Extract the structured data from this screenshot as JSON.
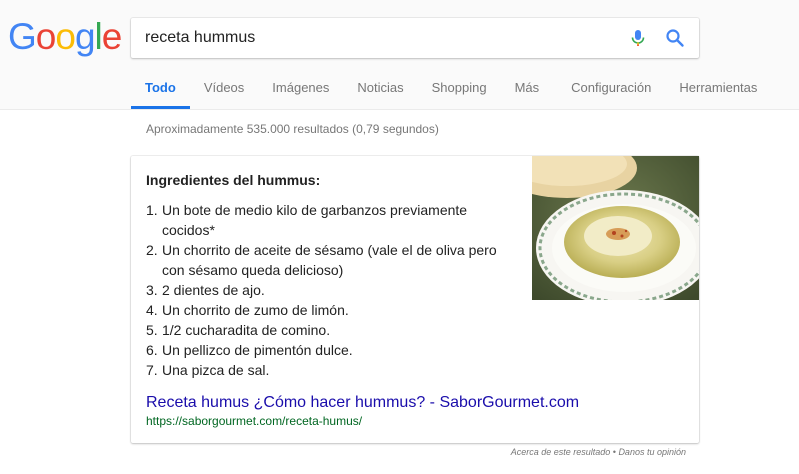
{
  "logo": {
    "text": "Google",
    "letters": [
      "G",
      "o",
      "o",
      "g",
      "l",
      "e"
    ],
    "colors": [
      "#4285F4",
      "#EA4335",
      "#FBBC05",
      "#4285F4",
      "#34A853",
      "#EA4335"
    ]
  },
  "search": {
    "value": "receta hummus",
    "mic_icon": "mic-icon",
    "search_icon": "search-icon"
  },
  "tabs": [
    {
      "label": "Todo",
      "active": true
    },
    {
      "label": "Vídeos"
    },
    {
      "label": "Imágenes"
    },
    {
      "label": "Noticias"
    },
    {
      "label": "Shopping"
    },
    {
      "label": "Más"
    },
    {
      "label": "Configuración"
    },
    {
      "label": "Herramientas"
    }
  ],
  "stats": "Aproximadamente 535.000 resultados (0,79 segundos)",
  "snippet": {
    "title": "Ingredientes del hummus:",
    "steps": [
      {
        "num": "1.",
        "text": "Un bote de medio kilo de garbanzos previamente cocidos*"
      },
      {
        "num": "2.",
        "text": "Un chorrito de aceite de sésamo (vale el de oliva pero con sésamo queda delicioso)"
      },
      {
        "num": "3.",
        "text": "2 dientes de ajo."
      },
      {
        "num": "4.",
        "text": "Un chorrito de zumo de limón."
      },
      {
        "num": "5.",
        "text": "1/2 cucharadita de comino."
      },
      {
        "num": "6.",
        "text": "Un pellizco de pimentón dulce."
      },
      {
        "num": "7.",
        "text": "Una pizca de sal."
      }
    ],
    "link_title": "Receta humus ¿Cómo hacer hummus? - SaborGourmet.com",
    "url": "https://saborgourmet.com/receta-humus/"
  },
  "footer": {
    "about": "Acerca de este resultado",
    "separator": " • ",
    "feedback": "Danos tu opinión"
  },
  "colors": {
    "link": "#1a0dab",
    "url": "#006621",
    "accent": "#1a73e8"
  }
}
